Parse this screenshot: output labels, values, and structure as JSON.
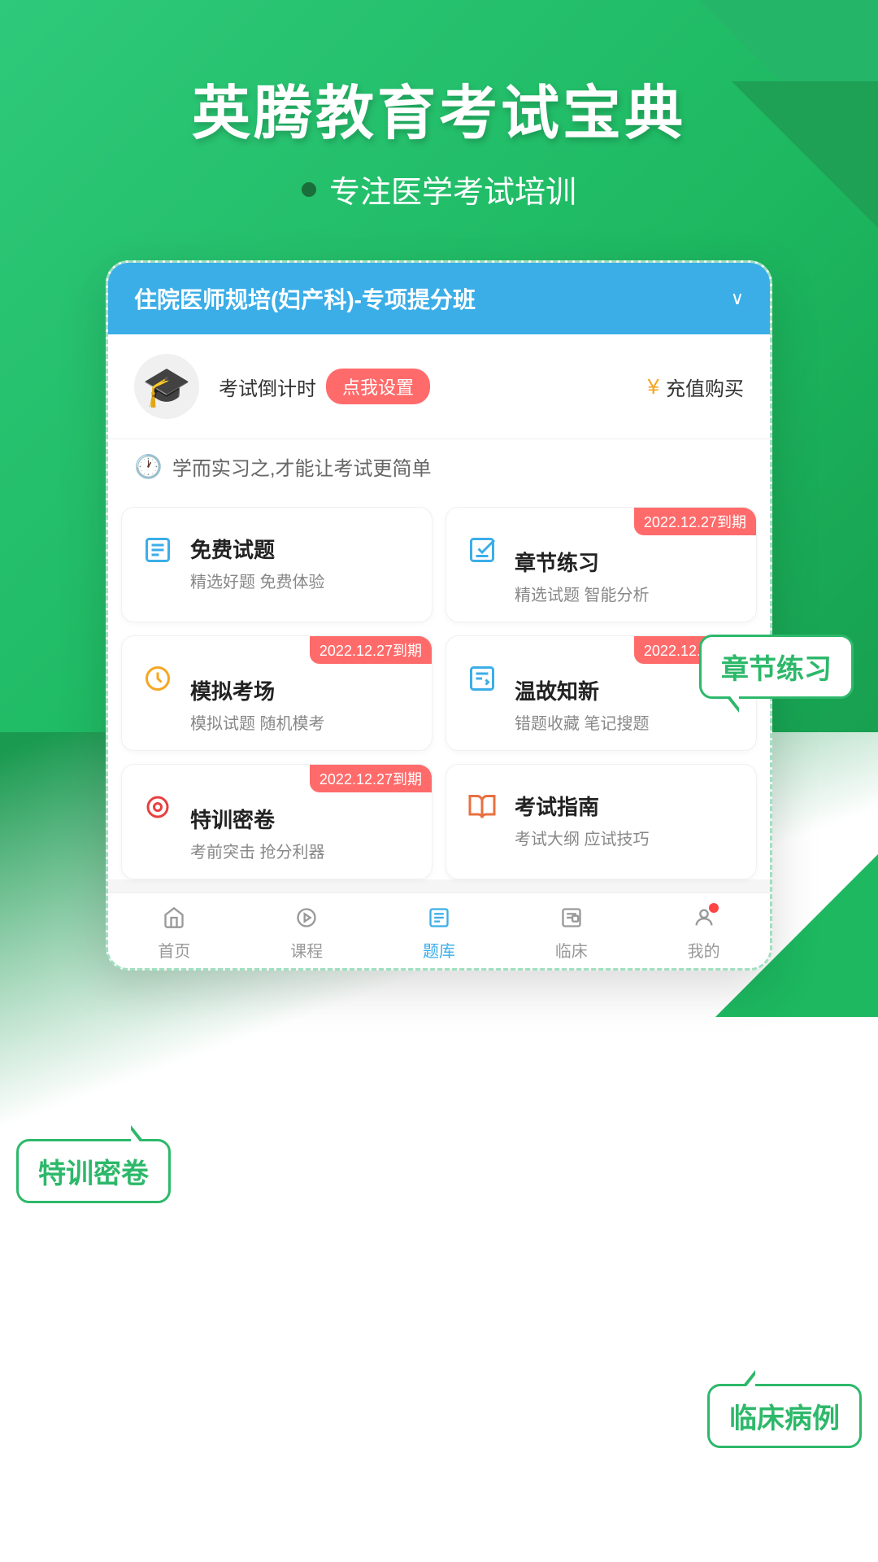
{
  "app": {
    "title": "英腾教育考试宝典",
    "subtitle": "专注医学考试培训",
    "topbar_title": "住院医师规培(妇产科)-专项提分班",
    "countdown_label": "考试倒计时",
    "set_button": "点我设置",
    "recharge_button": "充值购买",
    "notice_text": "学而实习之,才能让考试更简单"
  },
  "features": [
    {
      "id": "free-questions",
      "name": "免费试题",
      "desc": "精选好题 免费体验",
      "icon": "📋",
      "icon_type": "blue",
      "has_badge": false,
      "badge_text": ""
    },
    {
      "id": "chapter-practice",
      "name": "章节练习",
      "desc": "精选试题 智能分析",
      "icon": "📝",
      "icon_type": "green",
      "has_badge": true,
      "badge_text": "2022.12.27到期"
    },
    {
      "id": "mock-exam",
      "name": "模拟考场",
      "desc": "模拟试题 随机模考",
      "icon": "⏰",
      "icon_type": "yellow",
      "has_badge": true,
      "badge_text": "2022.12.27到期"
    },
    {
      "id": "review",
      "name": "温故知新",
      "desc": "错题收藏 笔记搜题",
      "icon": "📋",
      "icon_type": "teal",
      "has_badge": true,
      "badge_text": "2022.12.27到期"
    },
    {
      "id": "special-exam",
      "name": "特训密卷",
      "desc": "考前突击 抢分利器",
      "icon": "🎯",
      "icon_type": "red",
      "has_badge": true,
      "badge_text": "2022.12.27到期"
    },
    {
      "id": "exam-guide",
      "name": "考试指南",
      "desc": "考试大纲 应试技巧",
      "icon": "🔖",
      "icon_type": "coral",
      "has_badge": false,
      "badge_text": ""
    }
  ],
  "nav": [
    {
      "id": "home",
      "label": "首页",
      "icon": "⌂",
      "active": false
    },
    {
      "id": "course",
      "label": "课程",
      "icon": "▷",
      "active": false
    },
    {
      "id": "question-bank",
      "label": "题库",
      "icon": "☰",
      "active": true
    },
    {
      "id": "clinical",
      "label": "临床",
      "icon": "📋",
      "active": false
    },
    {
      "id": "mine",
      "label": "我的",
      "icon": "○",
      "active": false,
      "has_badge": true
    }
  ],
  "callouts": {
    "chapter_practice": "章节练习",
    "special_exam": "特训密卷",
    "clinical_case": "临床病例"
  }
}
